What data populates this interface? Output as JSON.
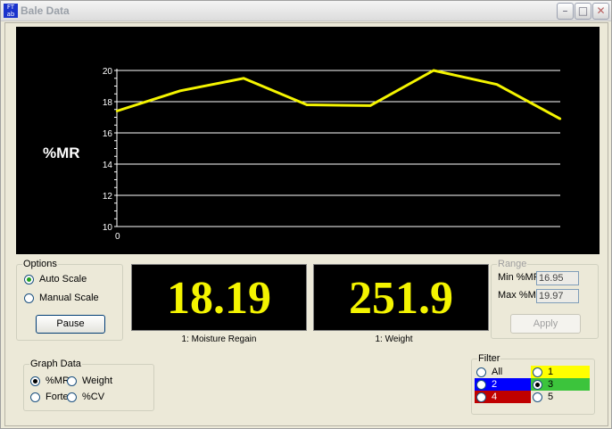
{
  "window": {
    "title": "Bale Data",
    "app_icon_text": "FT ab",
    "min_icon": "minimize-icon",
    "max_icon": "maximize-icon",
    "close_icon": "close-icon"
  },
  "chart": {
    "ylabel": "%MR",
    "x_origin_label": "0"
  },
  "chart_data": {
    "type": "line",
    "title": "",
    "xlabel": "",
    "ylabel": "%MR",
    "ylim": [
      10,
      20
    ],
    "yticks": [
      "20",
      "18",
      "16",
      "14",
      "12",
      "10"
    ],
    "grid": true,
    "series": [
      {
        "values": [
          17.4,
          18.7,
          19.5,
          17.8,
          17.75,
          20.0,
          19.1,
          16.9
        ],
        "color": "#f4f400"
      }
    ]
  },
  "options": {
    "legend": "Options",
    "auto_scale": "Auto Scale",
    "manual_scale": "Manual Scale",
    "selected": "Auto Scale",
    "pause_label": "Pause"
  },
  "readouts": {
    "moisture": {
      "value": "18.19",
      "caption": "1:  Moisture Regain"
    },
    "weight": {
      "value": "251.9",
      "caption": "1:  Weight"
    }
  },
  "range": {
    "legend": "Range",
    "min_label": "Min %MR",
    "min_value": "16.95",
    "max_label": "Max %MR",
    "max_value": "19.97",
    "apply_label": "Apply"
  },
  "graph_data": {
    "legend": "Graph Data",
    "mr": "%MR",
    "weight": "Weight",
    "forte": "Forte",
    "cv": "%CV",
    "selected": "%MR"
  },
  "filter": {
    "legend": "Filter",
    "all": "All",
    "f1": "1",
    "f2": "2",
    "f3": "3",
    "f4": "4",
    "f5": "5",
    "selected": "3",
    "colors": {
      "1": "#ffff00",
      "2": "#0000ff",
      "3": "#3cc43c",
      "4": "#c00000"
    }
  }
}
